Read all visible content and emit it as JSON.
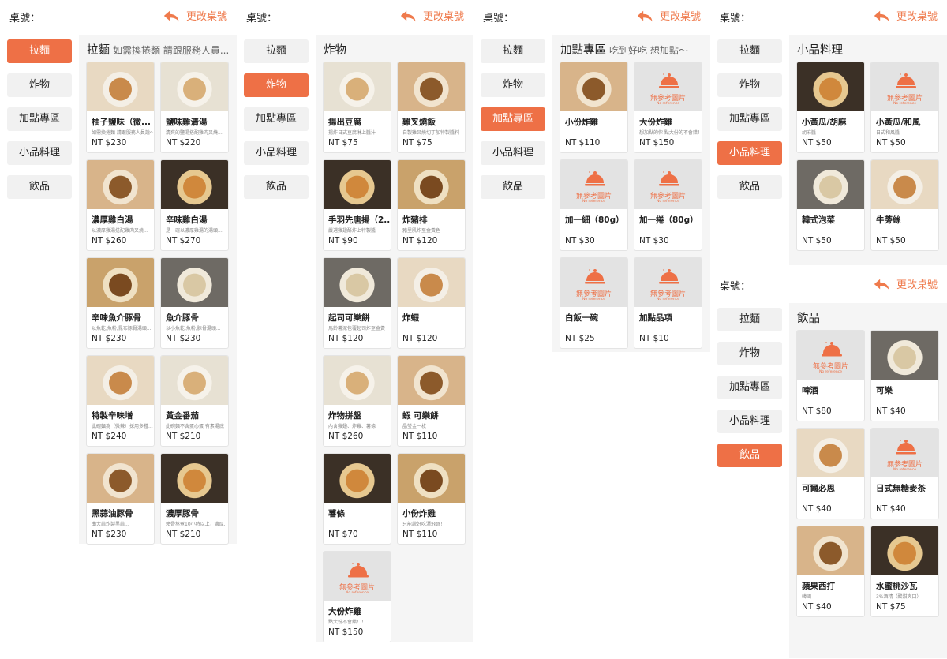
{
  "header": {
    "table_label": "桌號：",
    "change_table": "更改桌號"
  },
  "categories": [
    "拉麵",
    "炸物",
    "加點專區",
    "小品料理",
    "飲品"
  ],
  "placeholder": {
    "title": "無參考圖片",
    "sub": "No reference"
  },
  "colors": {
    "accent": "#ee7046",
    "panel_bg": "#f5f5f5",
    "button_bg": "#f1f1f1",
    "placeholder_bg": "#e3e3e3"
  },
  "sections": {
    "ramen": {
      "title": "拉麵",
      "subtitle": "如需換捲麵 請跟服務人員...",
      "items": [
        {
          "name": "柚子鹽味（微...",
          "desc": "如需換捲麵 請跟服務人員說～",
          "price": "NT $230",
          "img": "food"
        },
        {
          "name": "鹽味雞清湯",
          "desc": "清爽的鹽湯搭配雞肉叉燒...",
          "price": "NT $220",
          "img": "food"
        },
        {
          "name": "濃厚雞白湯",
          "desc": "以濃厚雞湯搭配雞肉叉燒...",
          "price": "NT $260",
          "img": "food"
        },
        {
          "name": "辛味雞白湯",
          "desc": "是一碗以濃厚雞湯的湯頭...",
          "price": "NT $270",
          "img": "food"
        },
        {
          "name": "辛味魚介豚骨",
          "desc": "以魚乾,魚粉,昆布豚骨湯頭...",
          "price": "NT $230",
          "img": "food"
        },
        {
          "name": "魚介豚骨",
          "desc": "以小魚乾,魚粉,豚骨湯頭...",
          "price": "NT $230",
          "img": "food"
        },
        {
          "name": "特製辛味增",
          "desc": "此碗麵為（微辣）採用多種...",
          "price": "NT $240",
          "img": "food"
        },
        {
          "name": "黃金番茄",
          "desc": "此碗麵不含蛋心蛋 有素湯底",
          "price": "NT $210",
          "img": "food"
        },
        {
          "name": "黑蒜油豚骨",
          "desc": "曲大蒜炸製黑蒜...",
          "price": "NT $230",
          "img": "food"
        },
        {
          "name": "濃厚豚骨",
          "desc": "豬骨熬煮10小時以上，濃厚...",
          "price": "NT $210",
          "img": "food"
        }
      ]
    },
    "fried": {
      "title": "炸物",
      "subtitle": "",
      "items": [
        {
          "name": "揚出豆腐",
          "desc": "揚炸日式豆腐淋上醬汁",
          "price": "NT $75",
          "img": "food"
        },
        {
          "name": "雞叉燒飯",
          "desc": "自製雞叉燒切丁加特製醬料",
          "price": "NT $75",
          "img": "food"
        },
        {
          "name": "手羽先唐揚（2...",
          "desc": "嚴選雞翅酥炸上特製醬",
          "price": "NT $90",
          "img": "food"
        },
        {
          "name": "炸豬排",
          "desc": "豬里肌炸至金黃色",
          "price": "NT $120",
          "img": "food"
        },
        {
          "name": "起司可樂餅",
          "desc": "馬鈴薯泥包覆起司炸至金黃",
          "price": "NT $120",
          "img": "food"
        },
        {
          "name": "炸蝦",
          "desc": "",
          "price": "NT $120",
          "img": "food"
        },
        {
          "name": "炸物拼盤",
          "desc": "內含雞翅、炸雞、薯條",
          "price": "NT $260",
          "img": "food"
        },
        {
          "name": "蝦 可樂餅",
          "desc": "晶瑩金一枚",
          "price": "NT $110",
          "img": "food"
        },
        {
          "name": "薯條",
          "desc": "",
          "price": "NT $70",
          "img": "food"
        },
        {
          "name": "小份炸雞",
          "desc": "只能說好吃渾飛哥！",
          "price": "NT $110",
          "img": "food"
        },
        {
          "name": "大份炸雞",
          "desc": "點大份不會錯！！",
          "price": "NT $150",
          "img": "placeholder"
        }
      ]
    },
    "extra": {
      "title": "加點專區",
      "subtitle": "吃到好吃 想加點～",
      "items": [
        {
          "name": "小份炸雞",
          "desc": "",
          "price": "NT $110",
          "img": "food"
        },
        {
          "name": "大份炸雞",
          "desc": "想加點的你 點大份的不會錯！",
          "price": "NT $150",
          "img": "placeholder"
        },
        {
          "name": "加一細（80g）",
          "desc": "",
          "price": "NT $30",
          "img": "placeholder"
        },
        {
          "name": "加一捲（80g）",
          "desc": "",
          "price": "NT $30",
          "img": "placeholder"
        },
        {
          "name": "白飯一碗",
          "desc": "",
          "price": "NT $25",
          "img": "placeholder"
        },
        {
          "name": "加點品項",
          "desc": "",
          "price": "NT $10",
          "img": "placeholder"
        }
      ]
    },
    "small": {
      "title": "小品料理",
      "subtitle": "",
      "items": [
        {
          "name": "小黃瓜/胡麻",
          "desc": "胡麻醬",
          "price": "NT $50",
          "img": "food"
        },
        {
          "name": "小黃瓜/和風",
          "desc": "日式和風醬",
          "price": "NT $50",
          "img": "placeholder"
        },
        {
          "name": "韓式泡菜",
          "desc": "",
          "price": "NT $50",
          "img": "food"
        },
        {
          "name": "牛蒡絲",
          "desc": "",
          "price": "NT $50",
          "img": "food"
        }
      ]
    },
    "drinks": {
      "title": "飲品",
      "subtitle": "",
      "items": [
        {
          "name": "啤酒",
          "desc": "",
          "price": "NT $80",
          "img": "placeholder"
        },
        {
          "name": "可樂",
          "desc": "",
          "price": "NT $40",
          "img": "food"
        },
        {
          "name": "可爾必思",
          "desc": "",
          "price": "NT $40",
          "img": "food"
        },
        {
          "name": "日式無糖麥茶",
          "desc": "",
          "price": "NT $40",
          "img": "placeholder"
        },
        {
          "name": "蘋果西打",
          "desc": "韓國",
          "price": "NT $40",
          "img": "food"
        },
        {
          "name": "水蜜桃沙瓦",
          "desc": "3%酒精（酸甜爽口）",
          "price": "NT $75",
          "img": "food"
        }
      ]
    }
  }
}
